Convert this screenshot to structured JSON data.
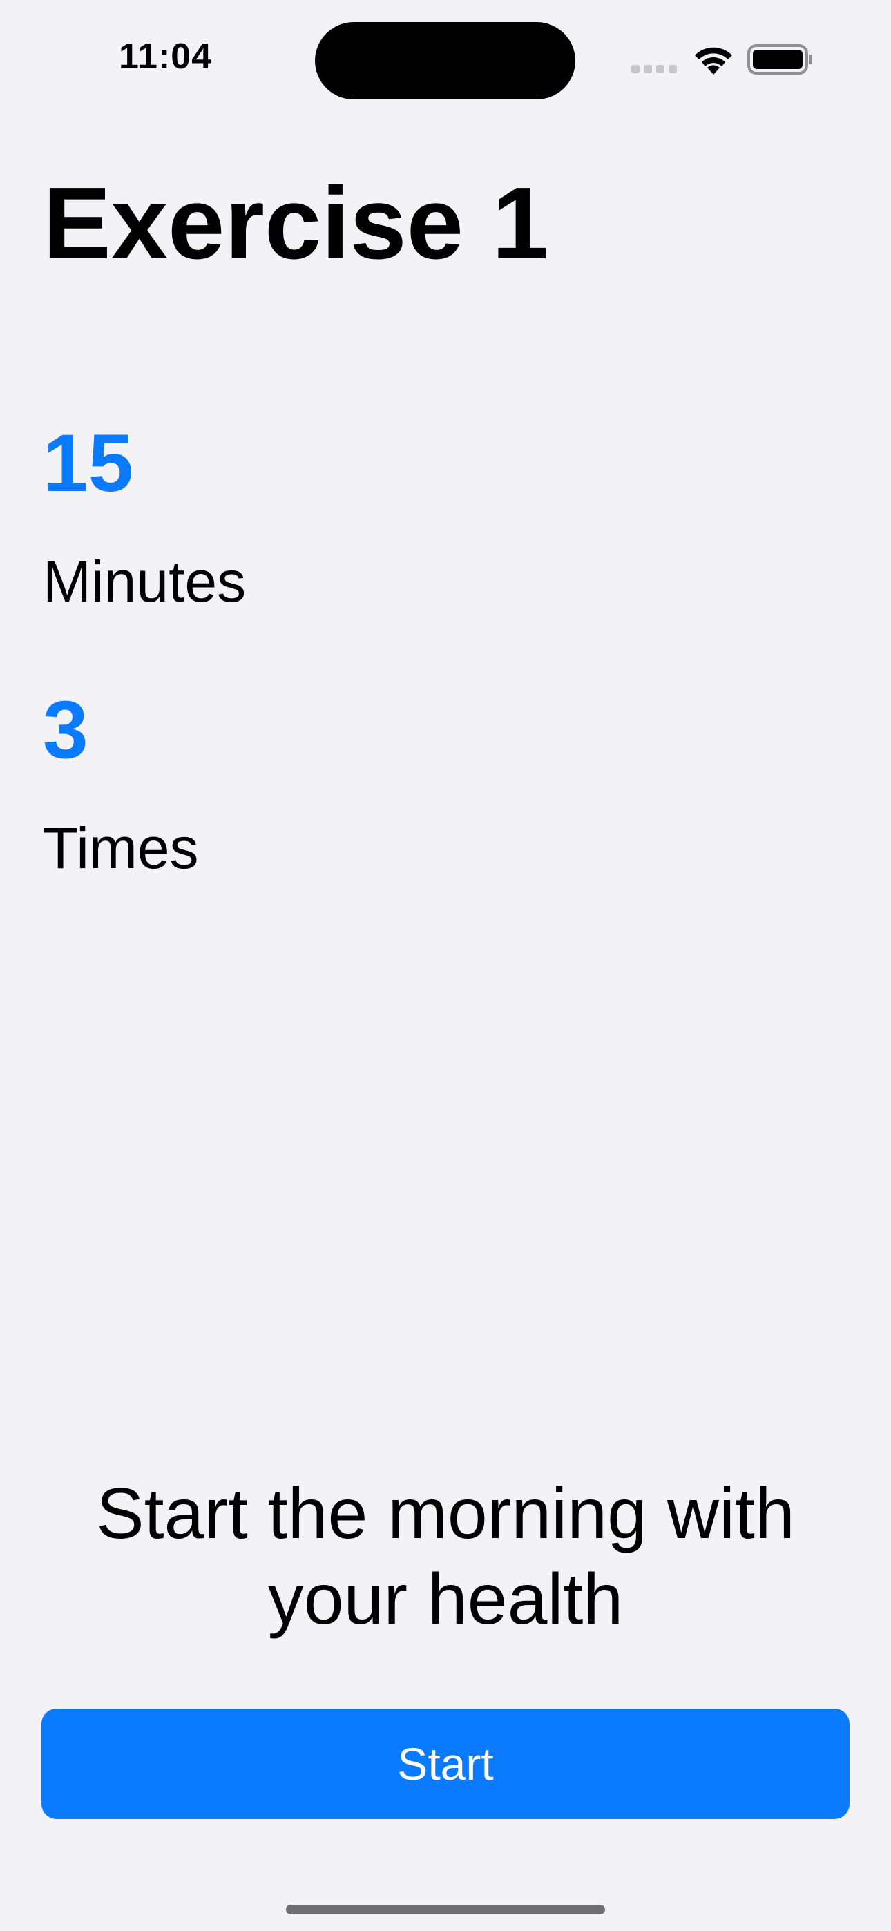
{
  "status_bar": {
    "time": "11:04",
    "signal_icon": "cellular-signal-icon",
    "wifi_icon": "wifi-icon",
    "battery_icon": "battery-icon"
  },
  "main": {
    "title": "Exercise 1",
    "stats": [
      {
        "value": "15",
        "unit": "Minutes"
      },
      {
        "value": "3",
        "unit": "Times"
      }
    ],
    "motivation": "Start the morning with your health"
  },
  "actions": {
    "start_label": "Start"
  },
  "colors": {
    "accent": "#0A7AFF",
    "background": "#F2F2F7"
  }
}
